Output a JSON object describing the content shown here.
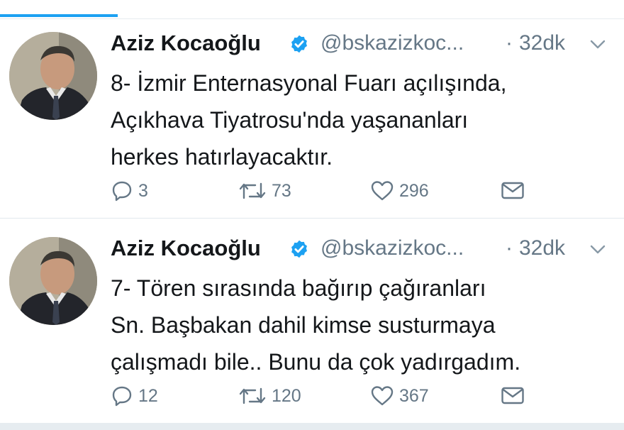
{
  "tweets": [
    {
      "name": "Aziz Kocaoğlu",
      "handle": "@bskazizkoc...",
      "separator": "·",
      "time": "32dk",
      "lines": [
        "8- İzmir Enternasyonal Fuarı açılışında,",
        "Açıkhava Tiyatrosu'nda yaşananları",
        "herkes hatırlayacaktır."
      ],
      "replies": "3",
      "retweets": "73",
      "likes": "296"
    },
    {
      "name": "Aziz Kocaoğlu",
      "handle": "@bskazizkoc...",
      "separator": "·",
      "time": "32dk",
      "lines": [
        "7- Tören sırasında bağırıp çağıranları",
        "Sn. Başbakan dahil kimse susturmaya",
        "çalışmadı bile.. Bunu da çok yadırgadım."
      ],
      "replies": "12",
      "retweets": "120",
      "likes": "367"
    }
  ],
  "colors": {
    "accent": "#1da1f2",
    "text": "#14171a",
    "secondary": "#657786"
  },
  "icons": [
    "verified-badge-icon",
    "chevron-down-icon",
    "reply-icon",
    "retweet-icon",
    "like-icon",
    "direct-message-icon"
  ]
}
